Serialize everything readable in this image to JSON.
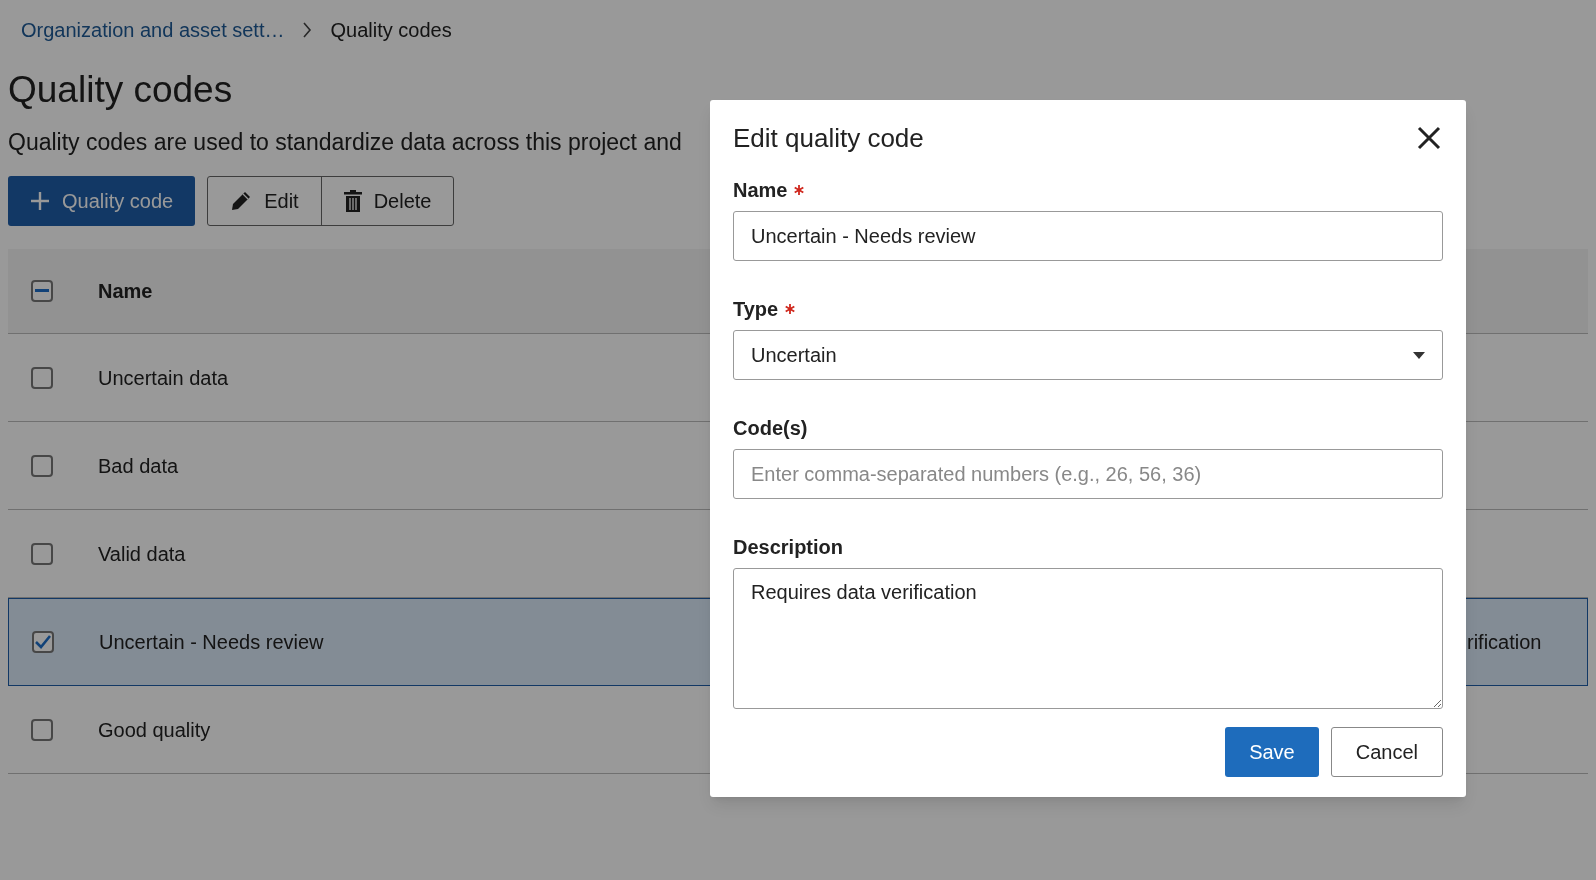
{
  "breadcrumb": [
    {
      "label": "Organization and asset sett…",
      "link": true
    },
    {
      "label": "Quality codes",
      "link": false
    }
  ],
  "page": {
    "title": "Quality codes",
    "description": "Quality codes are used to standardize data across this project and"
  },
  "toolbar": [
    {
      "label": "Quality code",
      "kind": "primary"
    },
    {
      "label": "Edit",
      "kind": "edit"
    },
    {
      "label": "Delete",
      "kind": "delete"
    }
  ],
  "table": {
    "header_checkbox": {
      "indeterminate": true
    },
    "columns": [
      "Name"
    ],
    "rows": [
      {
        "name": "Uncertain data",
        "selected": false
      },
      {
        "name": "Bad data",
        "selected": false
      },
      {
        "name": "Valid data",
        "selected": false
      },
      {
        "name": "Uncertain - Needs review",
        "selected": true,
        "column_2": "rification"
      },
      {
        "name": "Good quality",
        "selected": false
      }
    ]
  },
  "dialog": {
    "title": "Edit quality code",
    "fields": [
      {
        "label": "Name",
        "required": true,
        "kind": "text",
        "value": "Uncertain - Needs review"
      },
      {
        "label": "Type",
        "required": true,
        "kind": "select",
        "value": "Uncertain"
      },
      {
        "label": "Code(s)",
        "required": false,
        "kind": "text",
        "placeholder": "Enter comma-separated numbers (e.g., 26, 56, 36)"
      },
      {
        "label": "Description",
        "required": false,
        "kind": "textarea",
        "value": "Requires data verification"
      }
    ],
    "buttons": [
      {
        "label": "Save",
        "kind": "primary"
      },
      {
        "label": "Cancel",
        "kind": "secondary"
      }
    ]
  }
}
